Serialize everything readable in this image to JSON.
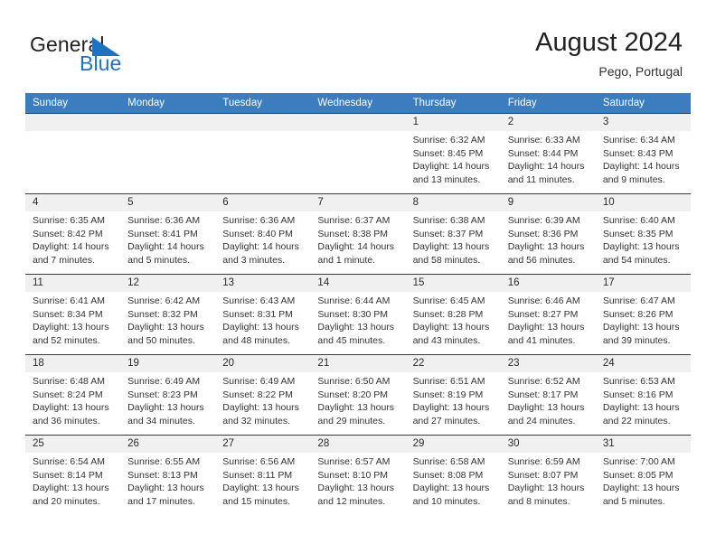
{
  "brand": {
    "name_part1": "General",
    "name_part2": "Blue",
    "mark": "triangle-flag-icon",
    "accent_color": "#1f72bd"
  },
  "header": {
    "title": "August 2024",
    "subtitle": "Pego, Portugal"
  },
  "colors": {
    "header_blue": "#3b7dbf",
    "day_number_band": "#f0f0f0",
    "row_divider": "#3a3a3a",
    "text": "#333333"
  },
  "weekdays": [
    "Sunday",
    "Monday",
    "Tuesday",
    "Wednesday",
    "Thursday",
    "Friday",
    "Saturday"
  ],
  "weeks": [
    [
      {
        "day": "",
        "empty": true
      },
      {
        "day": "",
        "empty": true
      },
      {
        "day": "",
        "empty": true
      },
      {
        "day": "",
        "empty": true
      },
      {
        "day": "1",
        "sunrise": "Sunrise: 6:32 AM",
        "sunset": "Sunset: 8:45 PM",
        "daylight": "Daylight: 14 hours and 13 minutes."
      },
      {
        "day": "2",
        "sunrise": "Sunrise: 6:33 AM",
        "sunset": "Sunset: 8:44 PM",
        "daylight": "Daylight: 14 hours and 11 minutes."
      },
      {
        "day": "3",
        "sunrise": "Sunrise: 6:34 AM",
        "sunset": "Sunset: 8:43 PM",
        "daylight": "Daylight: 14 hours and 9 minutes."
      }
    ],
    [
      {
        "day": "4",
        "sunrise": "Sunrise: 6:35 AM",
        "sunset": "Sunset: 8:42 PM",
        "daylight": "Daylight: 14 hours and 7 minutes."
      },
      {
        "day": "5",
        "sunrise": "Sunrise: 6:36 AM",
        "sunset": "Sunset: 8:41 PM",
        "daylight": "Daylight: 14 hours and 5 minutes."
      },
      {
        "day": "6",
        "sunrise": "Sunrise: 6:36 AM",
        "sunset": "Sunset: 8:40 PM",
        "daylight": "Daylight: 14 hours and 3 minutes."
      },
      {
        "day": "7",
        "sunrise": "Sunrise: 6:37 AM",
        "sunset": "Sunset: 8:38 PM",
        "daylight": "Daylight: 14 hours and 1 minute."
      },
      {
        "day": "8",
        "sunrise": "Sunrise: 6:38 AM",
        "sunset": "Sunset: 8:37 PM",
        "daylight": "Daylight: 13 hours and 58 minutes."
      },
      {
        "day": "9",
        "sunrise": "Sunrise: 6:39 AM",
        "sunset": "Sunset: 8:36 PM",
        "daylight": "Daylight: 13 hours and 56 minutes."
      },
      {
        "day": "10",
        "sunrise": "Sunrise: 6:40 AM",
        "sunset": "Sunset: 8:35 PM",
        "daylight": "Daylight: 13 hours and 54 minutes."
      }
    ],
    [
      {
        "day": "11",
        "sunrise": "Sunrise: 6:41 AM",
        "sunset": "Sunset: 8:34 PM",
        "daylight": "Daylight: 13 hours and 52 minutes."
      },
      {
        "day": "12",
        "sunrise": "Sunrise: 6:42 AM",
        "sunset": "Sunset: 8:32 PM",
        "daylight": "Daylight: 13 hours and 50 minutes."
      },
      {
        "day": "13",
        "sunrise": "Sunrise: 6:43 AM",
        "sunset": "Sunset: 8:31 PM",
        "daylight": "Daylight: 13 hours and 48 minutes."
      },
      {
        "day": "14",
        "sunrise": "Sunrise: 6:44 AM",
        "sunset": "Sunset: 8:30 PM",
        "daylight": "Daylight: 13 hours and 45 minutes."
      },
      {
        "day": "15",
        "sunrise": "Sunrise: 6:45 AM",
        "sunset": "Sunset: 8:28 PM",
        "daylight": "Daylight: 13 hours and 43 minutes."
      },
      {
        "day": "16",
        "sunrise": "Sunrise: 6:46 AM",
        "sunset": "Sunset: 8:27 PM",
        "daylight": "Daylight: 13 hours and 41 minutes."
      },
      {
        "day": "17",
        "sunrise": "Sunrise: 6:47 AM",
        "sunset": "Sunset: 8:26 PM",
        "daylight": "Daylight: 13 hours and 39 minutes."
      }
    ],
    [
      {
        "day": "18",
        "sunrise": "Sunrise: 6:48 AM",
        "sunset": "Sunset: 8:24 PM",
        "daylight": "Daylight: 13 hours and 36 minutes."
      },
      {
        "day": "19",
        "sunrise": "Sunrise: 6:49 AM",
        "sunset": "Sunset: 8:23 PM",
        "daylight": "Daylight: 13 hours and 34 minutes."
      },
      {
        "day": "20",
        "sunrise": "Sunrise: 6:49 AM",
        "sunset": "Sunset: 8:22 PM",
        "daylight": "Daylight: 13 hours and 32 minutes."
      },
      {
        "day": "21",
        "sunrise": "Sunrise: 6:50 AM",
        "sunset": "Sunset: 8:20 PM",
        "daylight": "Daylight: 13 hours and 29 minutes."
      },
      {
        "day": "22",
        "sunrise": "Sunrise: 6:51 AM",
        "sunset": "Sunset: 8:19 PM",
        "daylight": "Daylight: 13 hours and 27 minutes."
      },
      {
        "day": "23",
        "sunrise": "Sunrise: 6:52 AM",
        "sunset": "Sunset: 8:17 PM",
        "daylight": "Daylight: 13 hours and 24 minutes."
      },
      {
        "day": "24",
        "sunrise": "Sunrise: 6:53 AM",
        "sunset": "Sunset: 8:16 PM",
        "daylight": "Daylight: 13 hours and 22 minutes."
      }
    ],
    [
      {
        "day": "25",
        "sunrise": "Sunrise: 6:54 AM",
        "sunset": "Sunset: 8:14 PM",
        "daylight": "Daylight: 13 hours and 20 minutes."
      },
      {
        "day": "26",
        "sunrise": "Sunrise: 6:55 AM",
        "sunset": "Sunset: 8:13 PM",
        "daylight": "Daylight: 13 hours and 17 minutes."
      },
      {
        "day": "27",
        "sunrise": "Sunrise: 6:56 AM",
        "sunset": "Sunset: 8:11 PM",
        "daylight": "Daylight: 13 hours and 15 minutes."
      },
      {
        "day": "28",
        "sunrise": "Sunrise: 6:57 AM",
        "sunset": "Sunset: 8:10 PM",
        "daylight": "Daylight: 13 hours and 12 minutes."
      },
      {
        "day": "29",
        "sunrise": "Sunrise: 6:58 AM",
        "sunset": "Sunset: 8:08 PM",
        "daylight": "Daylight: 13 hours and 10 minutes."
      },
      {
        "day": "30",
        "sunrise": "Sunrise: 6:59 AM",
        "sunset": "Sunset: 8:07 PM",
        "daylight": "Daylight: 13 hours and 8 minutes."
      },
      {
        "day": "31",
        "sunrise": "Sunrise: 7:00 AM",
        "sunset": "Sunset: 8:05 PM",
        "daylight": "Daylight: 13 hours and 5 minutes."
      }
    ]
  ]
}
